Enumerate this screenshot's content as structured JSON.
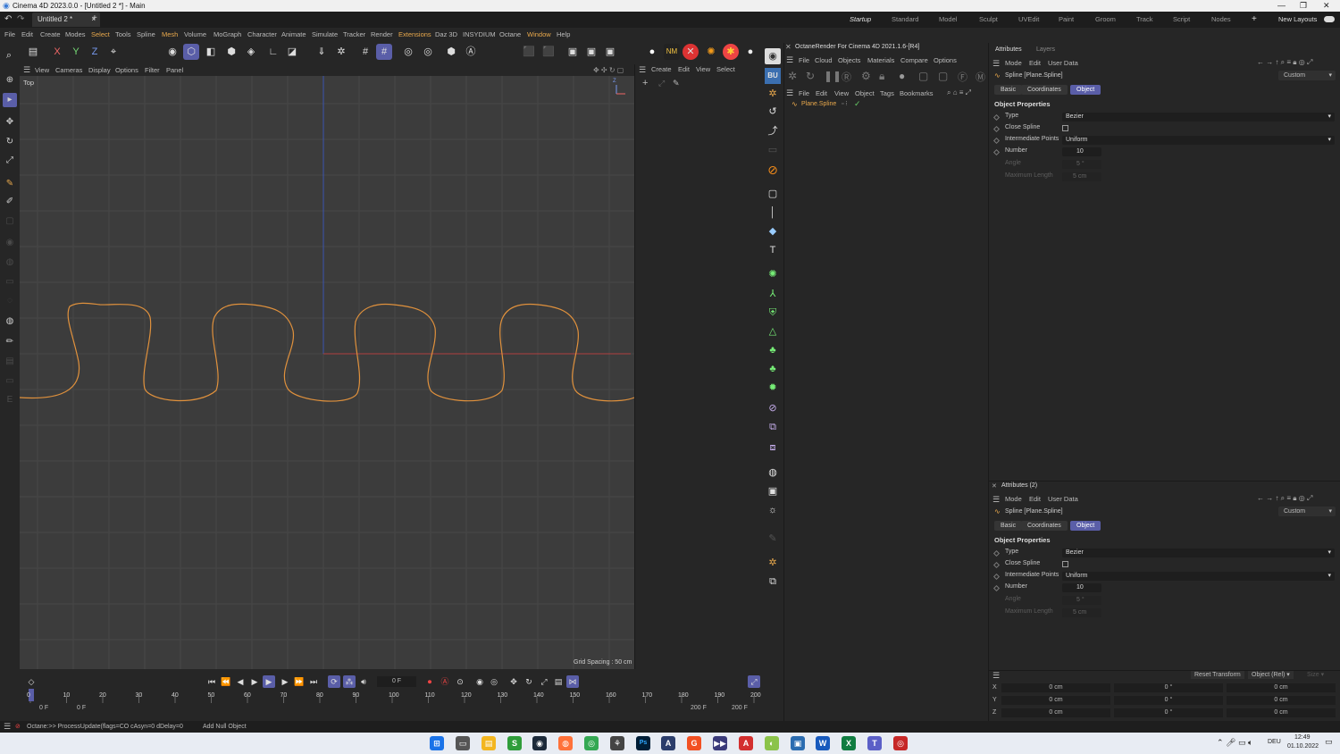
{
  "window": {
    "title": "Cinema 4D 2023.0.0 - [Untitled 2 *] - Main"
  },
  "doc_tab": {
    "label": "Untitled 2 *",
    "close": "×",
    "add": "+"
  },
  "layouts": [
    "Startup",
    "Standard",
    "Model",
    "Sculpt",
    "UVEdit",
    "Paint",
    "Groom",
    "Track",
    "Script",
    "Nodes"
  ],
  "layouts_extra": {
    "add": "+",
    "new_layouts": "New Layouts"
  },
  "menu": [
    "File",
    "Edit",
    "Create",
    "Modes",
    "Select",
    "Tools",
    "Spline",
    "Mesh",
    "Volume",
    "MoGraph",
    "Character",
    "Animate",
    "Simulate",
    "Tracker",
    "Render",
    "Extensions",
    "Daz 3D",
    "INSYDIUM",
    "Octane",
    "Window",
    "Help"
  ],
  "toolbar": {
    "x": "X",
    "y": "Y",
    "z": "Z"
  },
  "viewport": {
    "menu": [
      "View",
      "Cameras",
      "Display",
      "Options",
      "Filter",
      "Panel"
    ],
    "view_name": "Top",
    "grid_spacing": "Grid Spacing : 50 cm",
    "axis_y": "Y",
    "axis_z": "Z",
    "spline_color": "#e0913c"
  },
  "object_manager": {
    "menu_top": [
      "Create",
      "Edit",
      "View",
      "Select"
    ],
    "menu": [
      "File",
      "Edit",
      "View",
      "Object",
      "Tags",
      "Bookmarks"
    ],
    "object_name": "Plane.Spline"
  },
  "octane": {
    "title": "OctaneRender For Cinema 4D 2021.1.6-[R4]",
    "menu": [
      "File",
      "Cloud",
      "Objects",
      "Materials",
      "Compare",
      "Options"
    ]
  },
  "attributes": {
    "tabs": [
      "Attributes",
      "Layers"
    ],
    "menu": [
      "Mode",
      "Edit",
      "User Data"
    ],
    "object": "Spline [Plane.Spline]",
    "preset": "Custom",
    "subtabs": [
      "Basic",
      "Coordinates",
      "Object"
    ],
    "section": "Object Properties",
    "props": {
      "type_label": "Type",
      "type_value": "Bezier",
      "close_label": "Close Spline",
      "interp_label": "Intermediate Points",
      "interp_value": "Uniform",
      "number_label": "Number",
      "number_value": "10",
      "angle_label": "Angle",
      "angle_value": "5 °",
      "maxlen_label": "Maximum Length",
      "maxlen_value": "5 cm"
    }
  },
  "attributes2": {
    "title": "Attributes (2)"
  },
  "coordinates": {
    "reset": "Reset Transform",
    "mode": "Object (Rel)",
    "size": "Size",
    "rows": [
      {
        "axis": "X",
        "pos": "0 cm",
        "rot": "0 °",
        "scale": "0 cm"
      },
      {
        "axis": "Y",
        "pos": "0 cm",
        "rot": "0 °",
        "scale": "0 cm"
      },
      {
        "axis": "Z",
        "pos": "0 cm",
        "rot": "0 °",
        "scale": "0 cm"
      }
    ]
  },
  "timeline": {
    "current_frame": "0 F",
    "ticks": [
      "0",
      "10",
      "20",
      "30",
      "40",
      "50",
      "60",
      "70",
      "80",
      "90",
      "100",
      "110",
      "120",
      "130",
      "140",
      "150",
      "160",
      "170",
      "180",
      "190",
      "200"
    ],
    "start": "0 F",
    "start2": "0 F",
    "end": "200 F",
    "end2": "200 F"
  },
  "status": {
    "message": "Octane:>> ProcessUpdate(flags=CO cAsyn=0 dDelay=0",
    "action": "Add Null Object"
  },
  "system": {
    "lang": "DEU",
    "time": "12:49",
    "date": "01.10.2022"
  },
  "accent": "#5a5ea8"
}
